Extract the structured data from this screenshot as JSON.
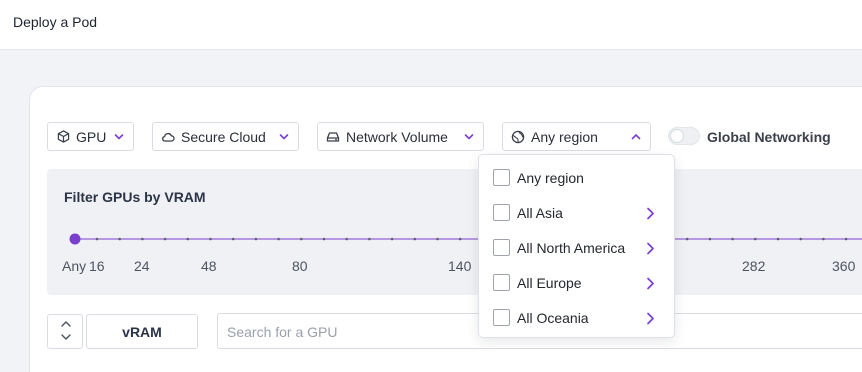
{
  "header": {
    "title": "Deploy a Pod"
  },
  "filters": {
    "gpu": {
      "label": "GPU",
      "icon": "cube-icon"
    },
    "cloud": {
      "label": "Secure Cloud",
      "icon": "cloud-icon"
    },
    "volume": {
      "label": "Network Volume",
      "icon": "drive-icon"
    },
    "region": {
      "label": "Any region",
      "icon": "globe-icon",
      "expanded": true
    }
  },
  "global_networking": {
    "label": "Global Networking",
    "enabled": false
  },
  "vram_filter": {
    "title": "Filter GPUs by VRAM",
    "selected": "Any",
    "tick_labels": [
      "Any",
      "16",
      "24",
      "48",
      "80",
      "140",
      "282",
      "360"
    ]
  },
  "region_dropdown": {
    "items": [
      {
        "label": "Any region",
        "checked": false,
        "has_submenu": false
      },
      {
        "label": "All Asia",
        "checked": false,
        "has_submenu": true
      },
      {
        "label": "All North America",
        "checked": false,
        "has_submenu": true
      },
      {
        "label": "All Europe",
        "checked": false,
        "has_submenu": true
      },
      {
        "label": "All Oceania",
        "checked": false,
        "has_submenu": true
      }
    ]
  },
  "sort": {
    "column_label": "vRAM"
  },
  "search": {
    "placeholder": "Search for a GPU",
    "value": ""
  },
  "colors": {
    "accent": "#7b3fd0",
    "panel": "#f0f1f4",
    "page_bg": "#f1f3f7",
    "border": "#d9dce3"
  }
}
